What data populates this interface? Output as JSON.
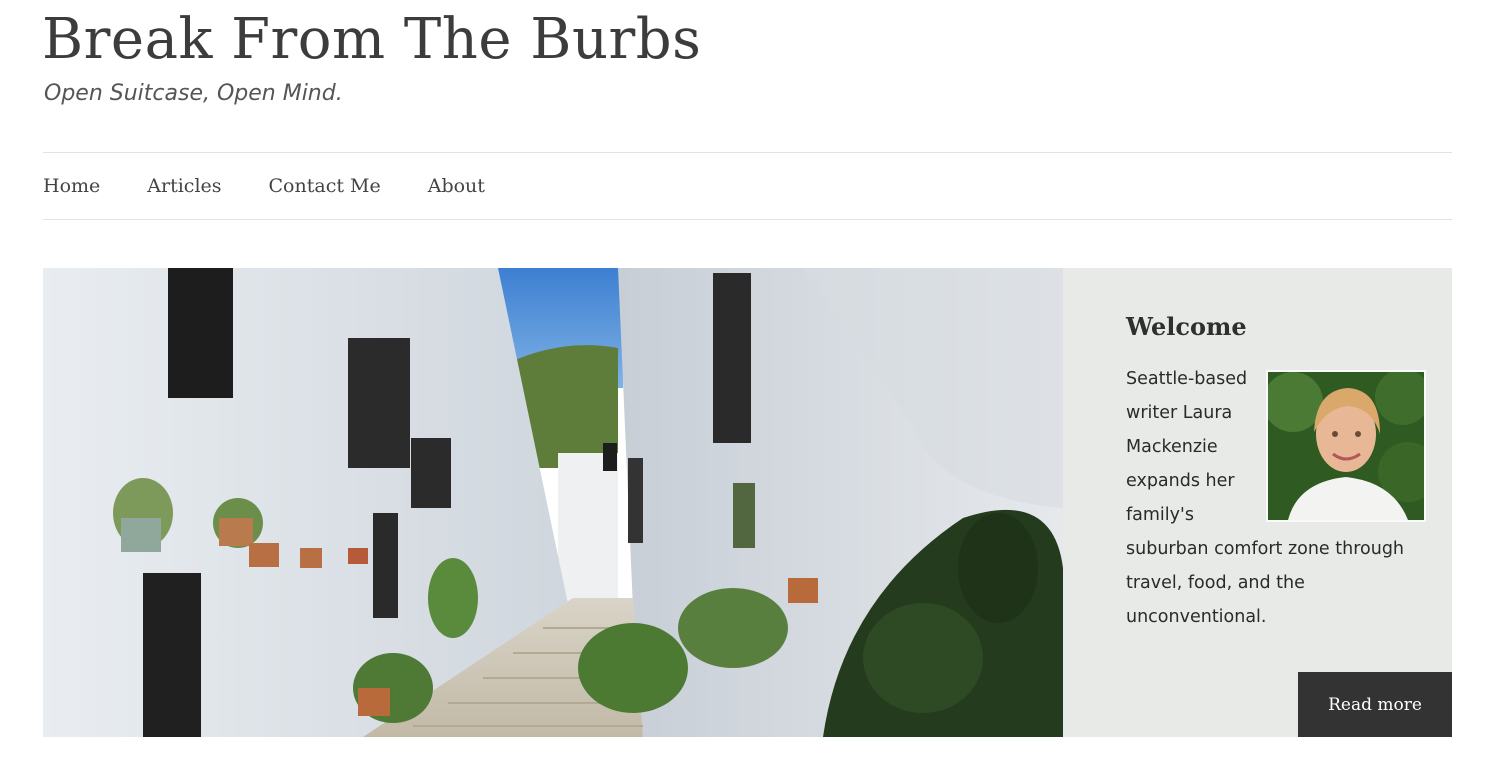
{
  "site": {
    "title": "Break From The Burbs",
    "tagline": "Open Suitcase, Open Mind."
  },
  "nav": {
    "items": [
      {
        "label": "Home"
      },
      {
        "label": "Articles"
      },
      {
        "label": "Contact Me"
      },
      {
        "label": "About"
      }
    ]
  },
  "welcome": {
    "title": "Welcome",
    "text": "Seattle-based writer Laura Mackenzie expands her family's suburban comfort zone through travel, food, and the unconventional.",
    "button_label": "Read more"
  },
  "colors": {
    "panel_bg": "#e8eae8",
    "button_bg": "#333333",
    "rule": "#e2e2e2"
  }
}
